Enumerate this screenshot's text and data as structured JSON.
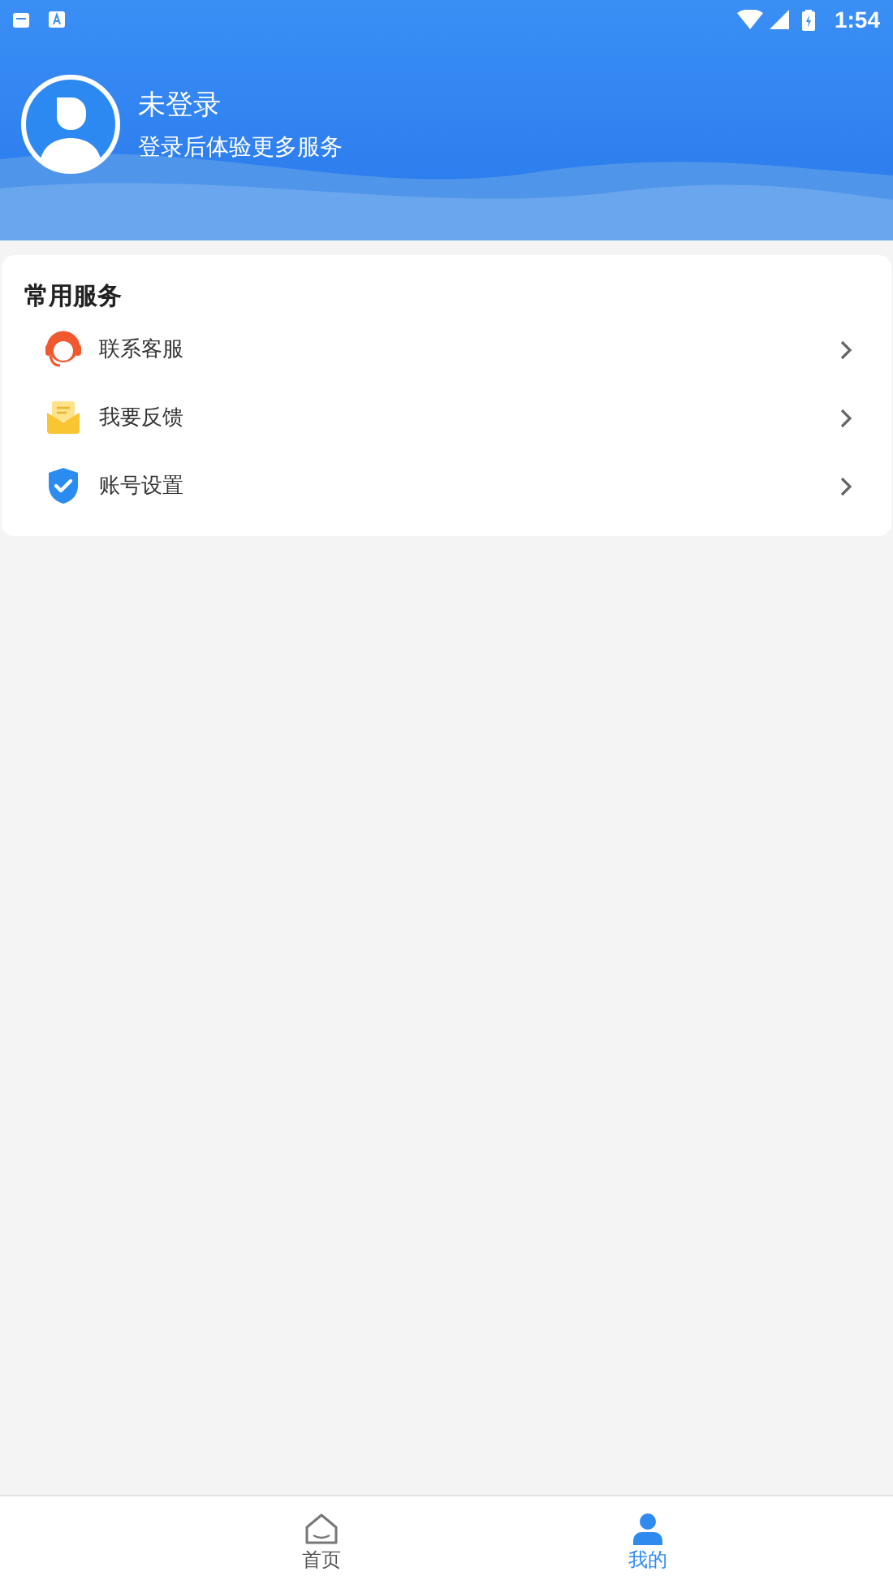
{
  "status_bar": {
    "time": "1:54"
  },
  "profile": {
    "name": "未登录",
    "subtitle": "登录后体验更多服务"
  },
  "services": {
    "title": "常用服务",
    "items": [
      {
        "label": "联系客服"
      },
      {
        "label": "我要反馈"
      },
      {
        "label": "账号设置"
      }
    ]
  },
  "tabs": [
    {
      "label": "首页",
      "selected": false
    },
    {
      "label": "我的",
      "selected": true
    }
  ]
}
